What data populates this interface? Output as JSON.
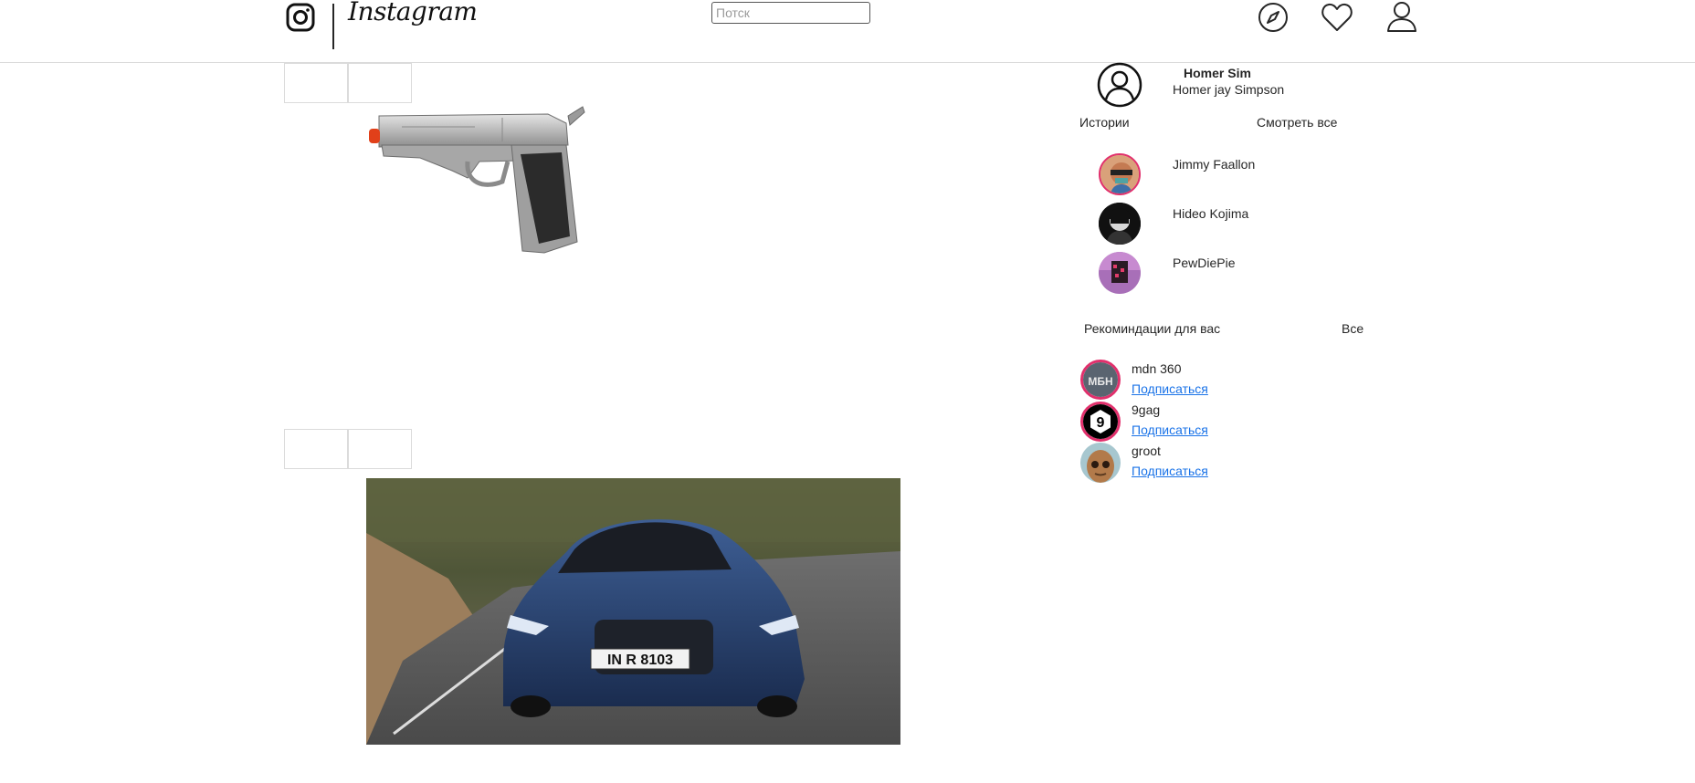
{
  "header": {
    "logo_text": "Instagram",
    "search_placeholder": "Потск"
  },
  "profile": {
    "username": "Homer Sim",
    "full_name": "Homer jay Simpson"
  },
  "stories": {
    "title": "Истории",
    "see_all": "Смотреть все",
    "items": [
      {
        "name": "Jimmy Faallon"
      },
      {
        "name": "Hideo Kojima"
      },
      {
        "name": "PewDiePie"
      }
    ]
  },
  "suggestions": {
    "title": "Рекоминдации для вас",
    "all": "Все",
    "items": [
      {
        "name": "mdn 360",
        "action": "Подписаться",
        "avatar_text": "МБН"
      },
      {
        "name": "9gag",
        "action": "Подписаться",
        "avatar_text": "9"
      },
      {
        "name": "groot",
        "action": "Подписаться"
      }
    ]
  },
  "posts": {
    "car_plate": "IN R 8103"
  },
  "colors": {
    "border": "#dbdbdb",
    "link": "#1a73e8",
    "story_ring": "#e1306c"
  }
}
